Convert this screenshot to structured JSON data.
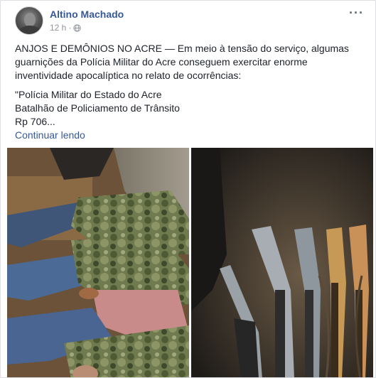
{
  "post": {
    "author": "Altino Machado",
    "time": "12 h",
    "separator": "·",
    "privacy_icon": "globe-icon",
    "more_icon": "more-options-icon",
    "body_paragraph_1": "ANJOS E DEMÔNIOS NO ACRE — Em meio à tensão do serviço, algumas guarnições da Polícia Militar do Acre conseguem exercitar enorme inventividade apocalíptica no relato de ocorrências:",
    "quote_line_1": "\"Polícia Militar do Estado do Acre",
    "quote_line_2": "Batalhão de Policiamento de Trânsito",
    "quote_line_3": "Rp 706...",
    "continue_label": "Continuar lendo"
  },
  "photos": [
    {
      "name": "photo-detained-men",
      "description_icon": "photo"
    },
    {
      "name": "photo-seized-rifles",
      "description_icon": "photo"
    }
  ],
  "colors": {
    "link": "#365899",
    "text": "#1d2129",
    "meta": "#90949c"
  }
}
